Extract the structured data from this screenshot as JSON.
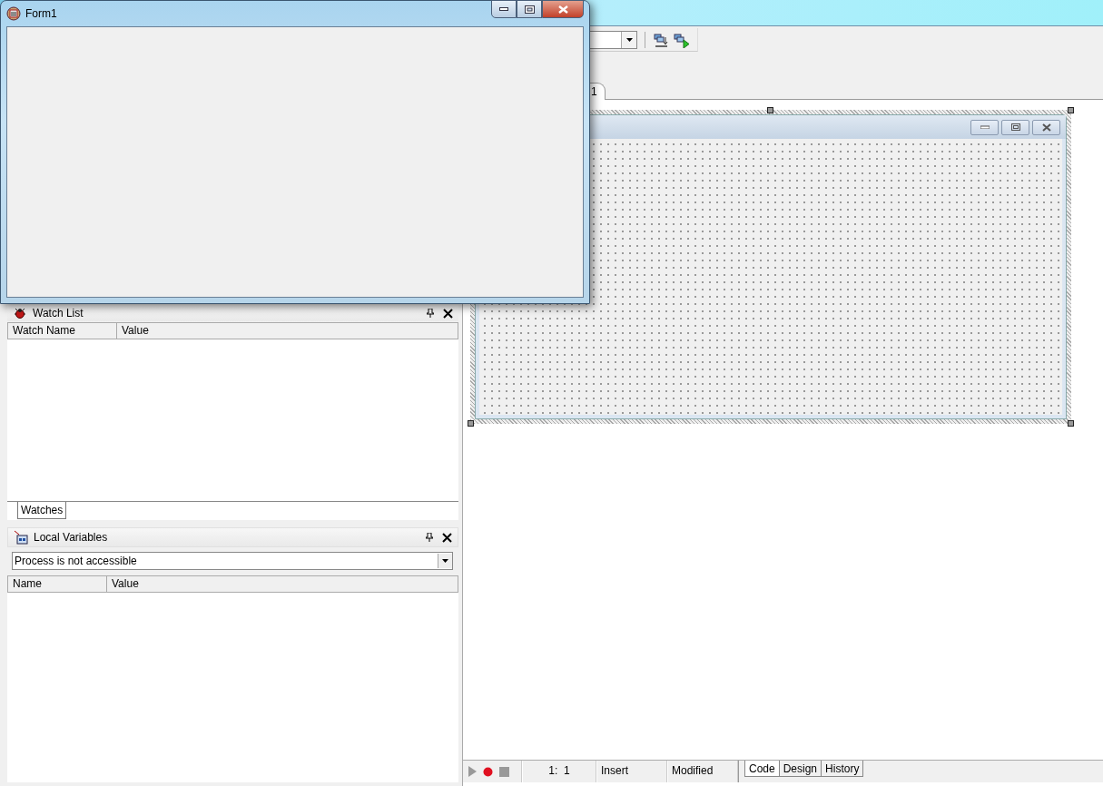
{
  "form_window": {
    "title": "Form1"
  },
  "editor_tabs": [
    {
      "label": "1",
      "selected": true
    }
  ],
  "watch_list": {
    "title": "Watch List",
    "columns": [
      "Watch Name",
      "Value"
    ],
    "tabs": [
      {
        "label": "Watches",
        "selected": true
      }
    ]
  },
  "local_variables": {
    "title": "Local Variables",
    "process": "Process is not accessible",
    "columns": [
      "Name",
      "Value"
    ]
  },
  "status_bar": {
    "position": "1:  1",
    "mode": "Insert",
    "state": "Modified",
    "tabs": [
      {
        "label": "Code",
        "selected": true
      },
      {
        "label": "Design",
        "selected": false
      },
      {
        "label": "History",
        "selected": false
      }
    ]
  }
}
